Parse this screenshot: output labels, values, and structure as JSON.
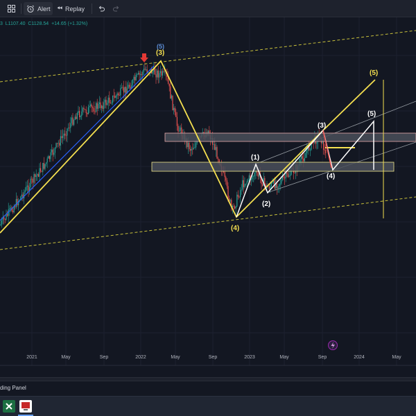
{
  "toolbar": {
    "alert_label": "Alert",
    "replay_label": "Replay"
  },
  "ohlc": {
    "text": "3  L1107.40  C1128.54  +14.65 (+1.32%)"
  },
  "chart_data": {
    "type": "candlestick",
    "x_tick_labels": [
      "2021",
      "May",
      "Sep",
      "2022",
      "May",
      "Sep",
      "2023",
      "May",
      "Sep",
      "2024",
      "May"
    ],
    "wave_labels": {
      "primary": [
        "(3)",
        "(4)",
        "(5)"
      ],
      "minor": [
        "(1)",
        "(2)",
        "(3)",
        "(4)",
        "(5)"
      ],
      "top_small": "(5)"
    },
    "colors": {
      "background": "#131722",
      "up_candle": "#26a69a",
      "down_candle": "#ef5350",
      "primary_wave": "#f5e050",
      "minor_wave": "#ffffff",
      "channel_dotted": "#c9c13b",
      "zone_fill": "#4a4f59",
      "zone_border": "#f0e68c",
      "marker": "#e53935",
      "lightning": "#9c27b0"
    }
  },
  "panel": {
    "label": "ding Panel"
  },
  "taskbar": {
    "apps": [
      "excel-icon",
      "presentation-icon"
    ]
  }
}
